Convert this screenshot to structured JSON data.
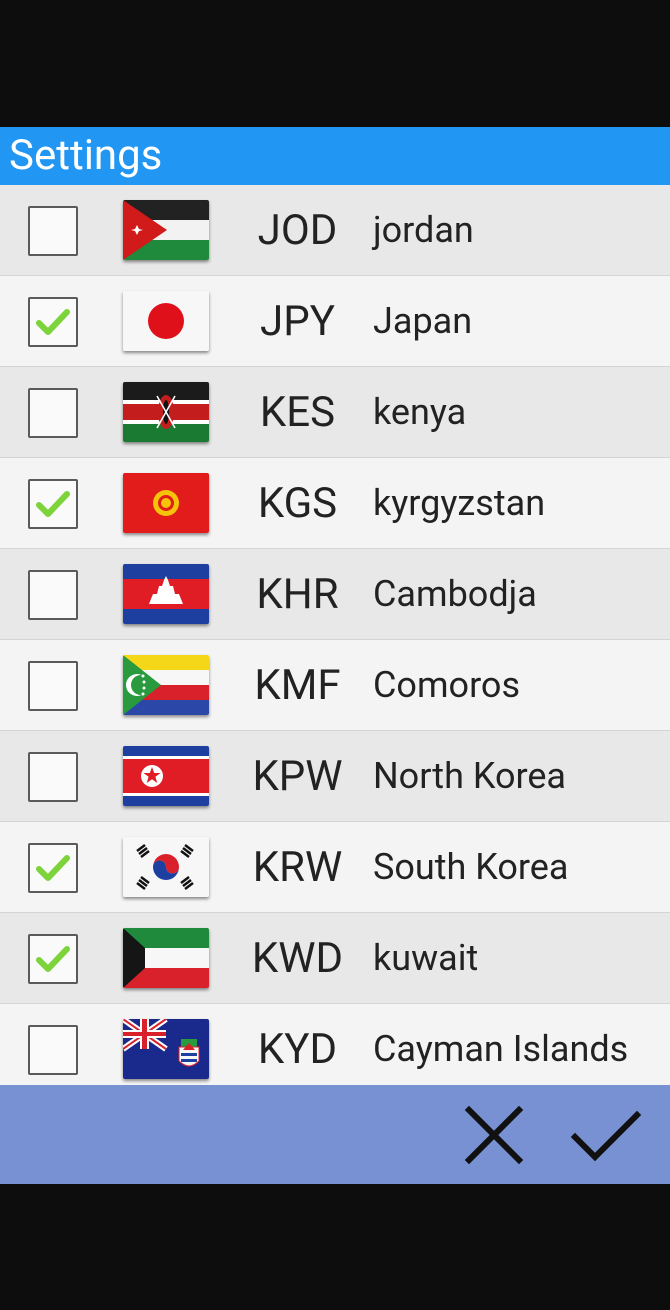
{
  "dialog": {
    "title": "Settings"
  },
  "currencies": [
    {
      "code": "JOD",
      "name": "jordan",
      "checked": false,
      "flag": "jordan-flag-icon"
    },
    {
      "code": "JPY",
      "name": "Japan",
      "checked": true,
      "flag": "japan-flag-icon"
    },
    {
      "code": "KES",
      "name": "kenya",
      "checked": false,
      "flag": "kenya-flag-icon"
    },
    {
      "code": "KGS",
      "name": "kyrgyzstan",
      "checked": true,
      "flag": "kyrgyzstan-flag-icon"
    },
    {
      "code": "KHR",
      "name": "Cambodja",
      "checked": false,
      "flag": "cambodia-flag-icon"
    },
    {
      "code": "KMF",
      "name": "Comoros",
      "checked": false,
      "flag": "comoros-flag-icon"
    },
    {
      "code": "KPW",
      "name": "North Korea",
      "checked": false,
      "flag": "north-korea-flag-icon"
    },
    {
      "code": "KRW",
      "name": "South Korea",
      "checked": true,
      "flag": "south-korea-flag-icon"
    },
    {
      "code": "KWD",
      "name": "kuwait",
      "checked": true,
      "flag": "kuwait-flag-icon"
    },
    {
      "code": "KYD",
      "name": "Cayman Islands",
      "checked": false,
      "flag": "cayman-islands-flag-icon"
    }
  ],
  "actions": {
    "cancel_icon": "close-icon",
    "confirm_icon": "check-icon"
  },
  "colors": {
    "title_bar": "#2196f3",
    "action_bar": "#7891d2",
    "check_mark": "#7cd33a"
  }
}
